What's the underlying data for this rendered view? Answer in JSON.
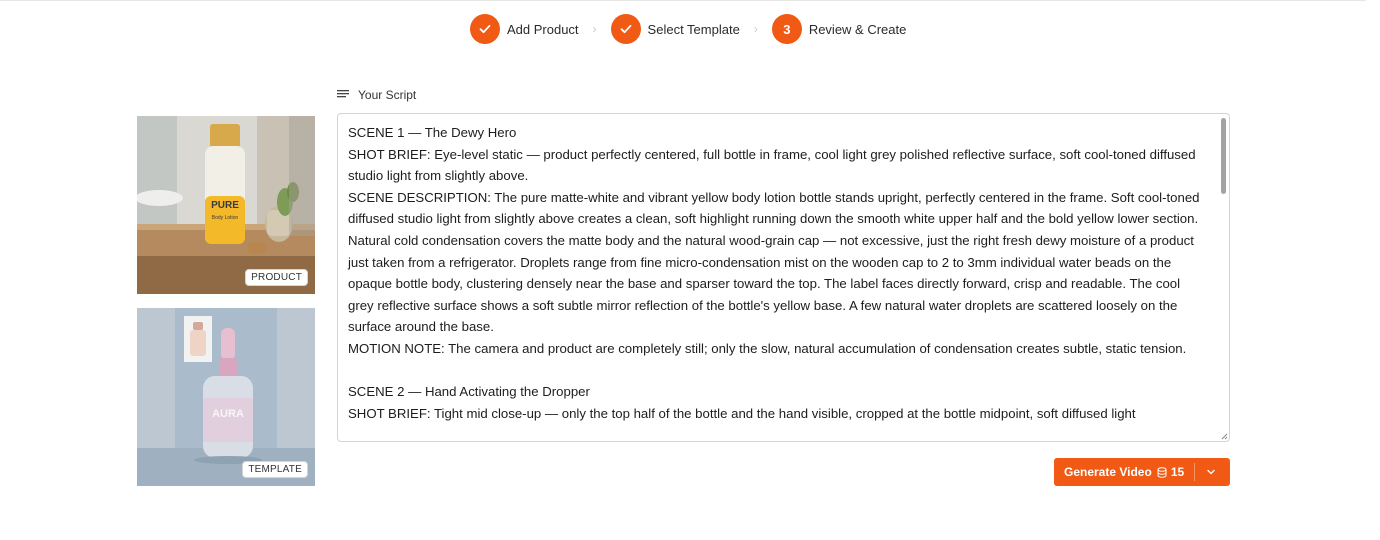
{
  "stepper": {
    "steps": [
      {
        "label": "Add Product",
        "status": "complete",
        "icon": "check-icon"
      },
      {
        "label": "Select Template",
        "status": "complete",
        "icon": "check-icon"
      },
      {
        "label": "Review & Create",
        "status": "current",
        "number": "3"
      }
    ]
  },
  "script": {
    "title": "Your Script",
    "icon": "lines-icon",
    "text": "SCENE 1 — The Dewy Hero\nSHOT BRIEF: Eye-level static — product perfectly centered, full bottle in frame, cool light grey polished reflective surface, soft cool-toned diffused studio light from slightly above.\nSCENE DESCRIPTION: The pure matte-white and vibrant yellow body lotion bottle stands upright, perfectly centered in the frame. Soft cool-toned diffused studio light from slightly above creates a clean, soft highlight running down the smooth white upper half and the bold yellow lower section. Natural cold condensation covers the matte body and the natural wood-grain cap — not excessive, just the right fresh dewy moisture of a product just taken from a refrigerator. Droplets range from fine micro-condensation mist on the wooden cap to 2 to 3mm individual water beads on the opaque bottle body, clustering densely near the base and sparser toward the top. The label faces directly forward, crisp and readable. The cool grey reflective surface shows a soft subtle mirror reflection of the bottle's yellow base. A few natural water droplets are scattered loosely on the surface around the base.\nMOTION NOTE: The camera and product are completely still; only the slow, natural accumulation of condensation creates subtle, static tension.\n\nSCENE 2 — Hand Activating the Dropper\nSHOT BRIEF: Tight mid close-up — only the top half of the bottle and the hand visible, cropped at the bottle midpoint, soft diffused light"
  },
  "images": {
    "product": {
      "badge": "PRODUCT",
      "bottle_text": "PURE",
      "bottle_subtext": "Body Lotion"
    },
    "template": {
      "badge": "TEMPLATE",
      "bottle_text": "AURA"
    }
  },
  "generate": {
    "label": "Generate Video",
    "credits": "15",
    "credit_icon": "coins-icon",
    "dropdown_icon": "chevron-down-icon"
  },
  "colors": {
    "accent": "#f05a14"
  }
}
